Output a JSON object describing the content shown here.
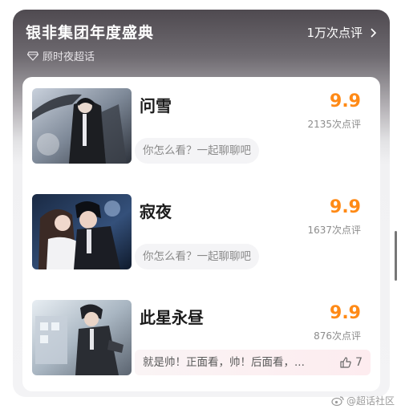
{
  "header": {
    "title": "银非集团年度盛典",
    "total_reviews": "1万次点评",
    "subtitle": "顾时夜超话"
  },
  "items": [
    {
      "name": "问雪",
      "score": "9.9",
      "count": "2135次点评",
      "prompt": "你怎么看？一起聊聊吧"
    },
    {
      "name": "寂夜",
      "score": "9.9",
      "count": "1637次点评",
      "prompt": "你怎么看？一起聊聊吧"
    },
    {
      "name": "此星永昼",
      "score": "9.9",
      "count": "876次点评",
      "comment": "就是帅！正面看，帅！后面看，...",
      "likes": "7"
    }
  ],
  "watermark": "@超话社区",
  "colors": {
    "score": "#ff8a16",
    "header_text": "#ffffff"
  }
}
